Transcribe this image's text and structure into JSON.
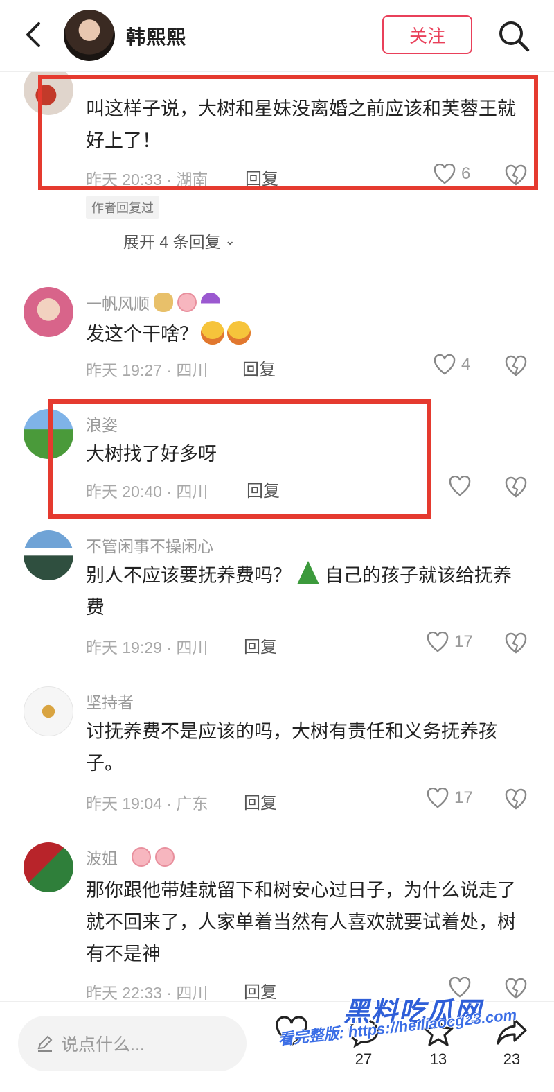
{
  "header": {
    "title": "韩熙熙",
    "follow_label": "关注"
  },
  "comments": [
    {
      "name": "",
      "text": "叫这样子说，大树和星妹没离婚之前应该和芙蓉王就好上了！",
      "time": "昨天 20:33 · 湖南",
      "reply": "回复",
      "likes": "6",
      "badge": "作者回复过",
      "expand": "展开 4 条回复"
    },
    {
      "name": "一帆风顺",
      "text": "发这个干啥？",
      "time": "昨天 19:27 · 四川",
      "reply": "回复",
      "likes": "4"
    },
    {
      "name": "浪姿",
      "text": "大树找了好多呀",
      "time": "昨天 20:40 · 四川",
      "reply": "回复",
      "likes": ""
    },
    {
      "name": "不管闲事不操闲心",
      "text_a": "别人不应该要抚养费吗？",
      "text_b": "自己的孩子就该给抚养费",
      "time": "昨天 19:29 · 四川",
      "reply": "回复",
      "likes": "17"
    },
    {
      "name": "坚持者",
      "text": "讨抚养费不是应该的吗，大树有责任和义务抚养孩子。",
      "time": "昨天 19:04 · 广东",
      "reply": "回复",
      "likes": "17"
    },
    {
      "name": "波姐",
      "text": "那你跟他带娃就留下和树安心过日子，为什么说走了就不回来了，人家单着当然有人喜欢就要试着处，树有不是神",
      "time": "昨天 22:33 · 四川",
      "reply": "回复",
      "likes": ""
    }
  ],
  "bottom": {
    "input_placeholder": "说点什么...",
    "comment_count": "27",
    "star_count": "13",
    "share_count": "23"
  },
  "watermark": {
    "title": "黑料吃瓜网",
    "url": "看完整版: https://heiliaocg23.com"
  },
  "colors": {
    "accent": "#e9405a",
    "highlight_box": "#e53a2f",
    "meta_gray": "#a8a8a8"
  }
}
